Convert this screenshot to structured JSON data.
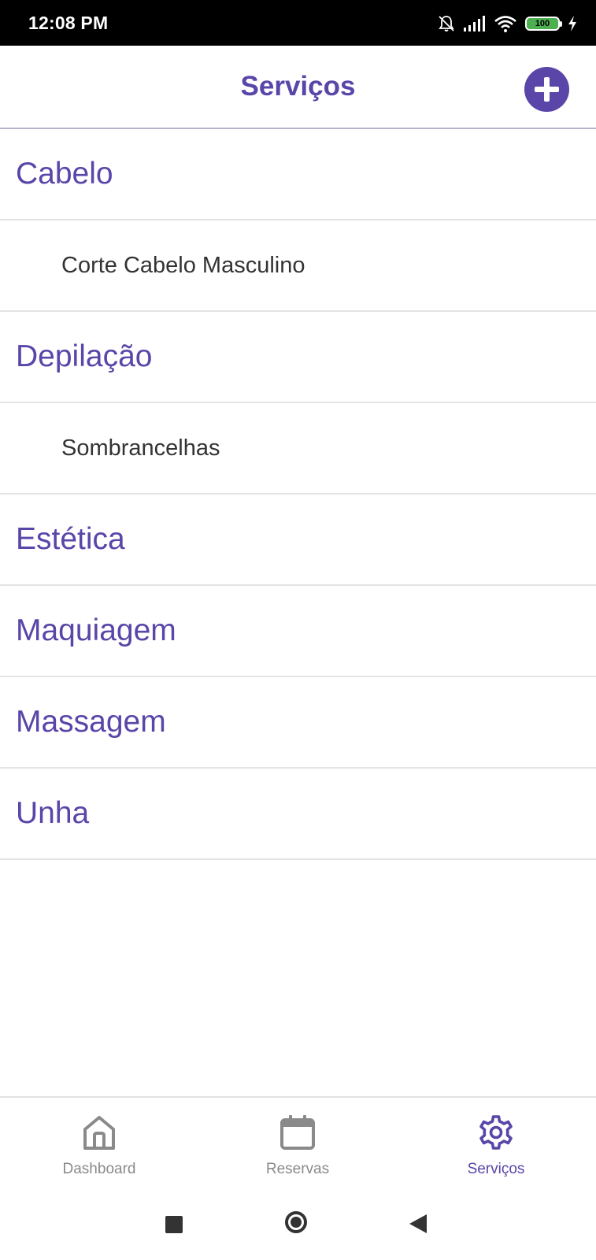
{
  "status_bar": {
    "time": "12:08 PM",
    "battery": "100"
  },
  "header": {
    "title": "Serviços"
  },
  "list": [
    {
      "type": "category",
      "label": "Cabelo"
    },
    {
      "type": "service",
      "label": "Corte Cabelo Masculino"
    },
    {
      "type": "category",
      "label": "Depilação"
    },
    {
      "type": "service",
      "label": "Sombrancelhas"
    },
    {
      "type": "category",
      "label": "Estética"
    },
    {
      "type": "category",
      "label": "Maquiagem"
    },
    {
      "type": "category",
      "label": "Massagem"
    },
    {
      "type": "category",
      "label": "Unha"
    }
  ],
  "bottom_nav": [
    {
      "label": "Dashboard",
      "icon": "home-icon",
      "active": false
    },
    {
      "label": "Reservas",
      "icon": "calendar-icon",
      "active": false
    },
    {
      "label": "Serviços",
      "icon": "gear-icon",
      "active": true
    }
  ],
  "colors": {
    "accent": "#5a45a8",
    "inactive": "#8a8a8a",
    "service_text": "#333333"
  }
}
